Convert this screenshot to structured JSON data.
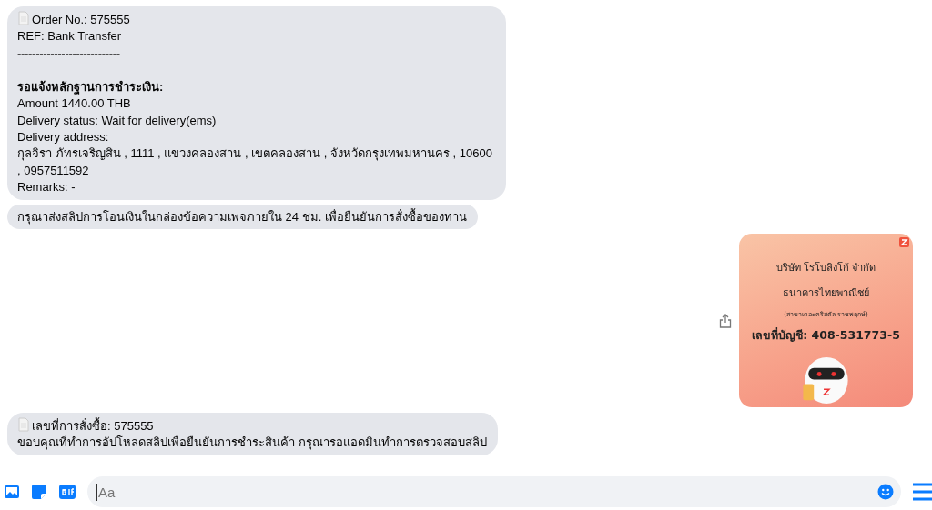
{
  "messages": [
    {
      "kind": "text",
      "doc_icon": true,
      "lines": [
        {
          "kind": "plain",
          "text": "Order No.: 575555"
        },
        {
          "kind": "plain",
          "text": "REF: Bank Transfer"
        },
        {
          "kind": "rule",
          "text": "----------------------------"
        },
        {
          "kind": "heading",
          "text": "รอแจ้งหลักฐานการชำระเงิน:"
        },
        {
          "kind": "plain",
          "text": "Amount 1440.00 THB"
        },
        {
          "kind": "plain",
          "text": "Delivery status: Wait for delivery(ems)"
        },
        {
          "kind": "plain",
          "text": "Delivery address:"
        },
        {
          "kind": "plain",
          "text": "กุลจิรา ภัทรเจริญสิน , 1111 , แขวงคลองสาน , เขตคลองสาน , จังหวัดกรุงเทพมหานคร , 10600 , 0957511592"
        },
        {
          "kind": "plain",
          "text": "Remarks: -"
        }
      ]
    },
    {
      "kind": "text",
      "doc_icon": false,
      "lines": [
        {
          "kind": "plain",
          "text": "กรุณาส่งสลิปการโอนเงินในกล่องข้อความเพจภายใน 24 ชม. เพื่อยืนยันการสั่งซื้อของท่าน"
        }
      ]
    },
    {
      "kind": "image",
      "company": "บริษัท โรโบลิงโก้ จำกัด",
      "bank": "ธนาคารไทยพาณิชย์",
      "branch": "(สาขาเดอะคริสตัล ราชพฤกษ์)",
      "account": "เลขที่บัญชี: 408-531773-5"
    },
    {
      "kind": "text",
      "doc_icon": true,
      "lines": [
        {
          "kind": "plain",
          "text": "เลขที่การสั่งซื้อ: 575555"
        },
        {
          "kind": "plain",
          "text": "ขอบคุณที่ทำการอัปโหลดสลิปเพื่อยืนยันการชำระสินค้า กรุณารอแอดมินทำการตรวจสอบสลิป"
        }
      ]
    }
  ],
  "composer": {
    "placeholder": "Aa"
  }
}
